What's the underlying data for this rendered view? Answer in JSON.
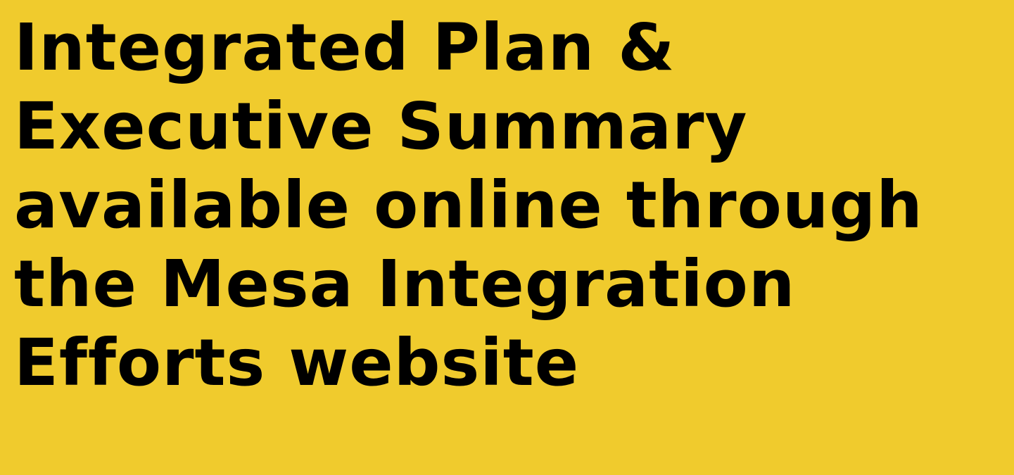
{
  "headline": {
    "lines": [
      "Integrated Plan &",
      "Executive Summary",
      "available online through",
      "the Mesa Integration",
      "Efforts website"
    ]
  },
  "colors": {
    "background": "#F0CB2D",
    "text": "#000000"
  }
}
